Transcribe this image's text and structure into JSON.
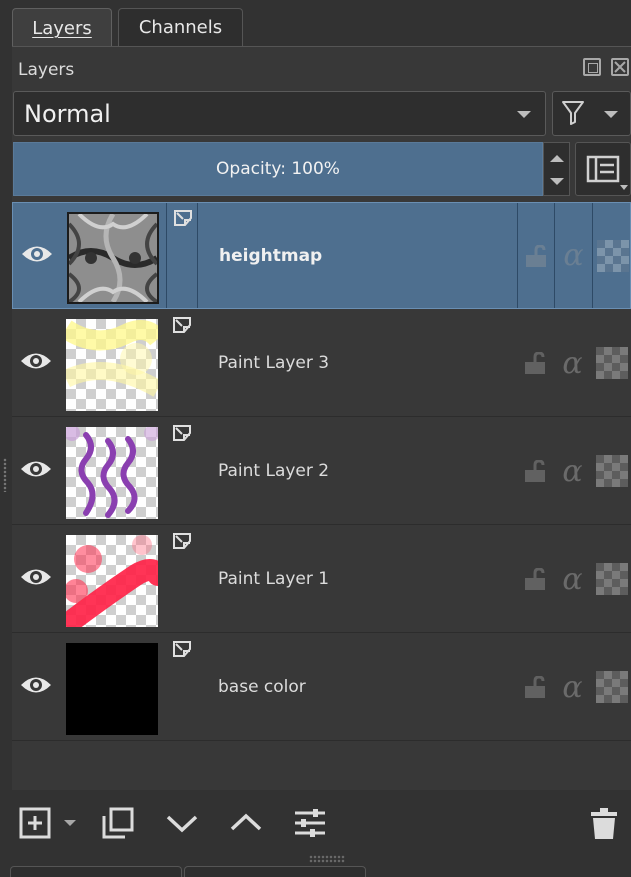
{
  "tabs": [
    {
      "label": "Layers",
      "active": true
    },
    {
      "label": "Channels",
      "active": false
    }
  ],
  "docker": {
    "title": "Layers"
  },
  "blend_mode": {
    "selected": "Normal"
  },
  "opacity": {
    "label": "Opacity:  100%",
    "value_percent": 100
  },
  "layers": [
    {
      "name": "heightmap",
      "visible": true,
      "selected": true,
      "thumbnail": "grayscale-noise"
    },
    {
      "name": "Paint Layer 3",
      "visible": true,
      "selected": false,
      "thumbnail": "yellow-strokes-on-checker"
    },
    {
      "name": "Paint Layer 2",
      "visible": true,
      "selected": false,
      "thumbnail": "purple-squiggles-on-checker"
    },
    {
      "name": "Paint Layer 1",
      "visible": true,
      "selected": false,
      "thumbnail": "red-strokes-on-checker"
    },
    {
      "name": "base color",
      "visible": true,
      "selected": false,
      "thumbnail": "solid-black"
    }
  ],
  "colors": {
    "selection": "#4e6f8f",
    "panel": "#383838",
    "background": "#323232",
    "icon": "#dcdcdc"
  },
  "toolbar": {
    "icons": [
      "add-layer-icon",
      "duplicate-layer-icon",
      "move-layer-down-icon",
      "move-layer-up-icon",
      "layer-properties-icon",
      "delete-layer-icon"
    ]
  }
}
